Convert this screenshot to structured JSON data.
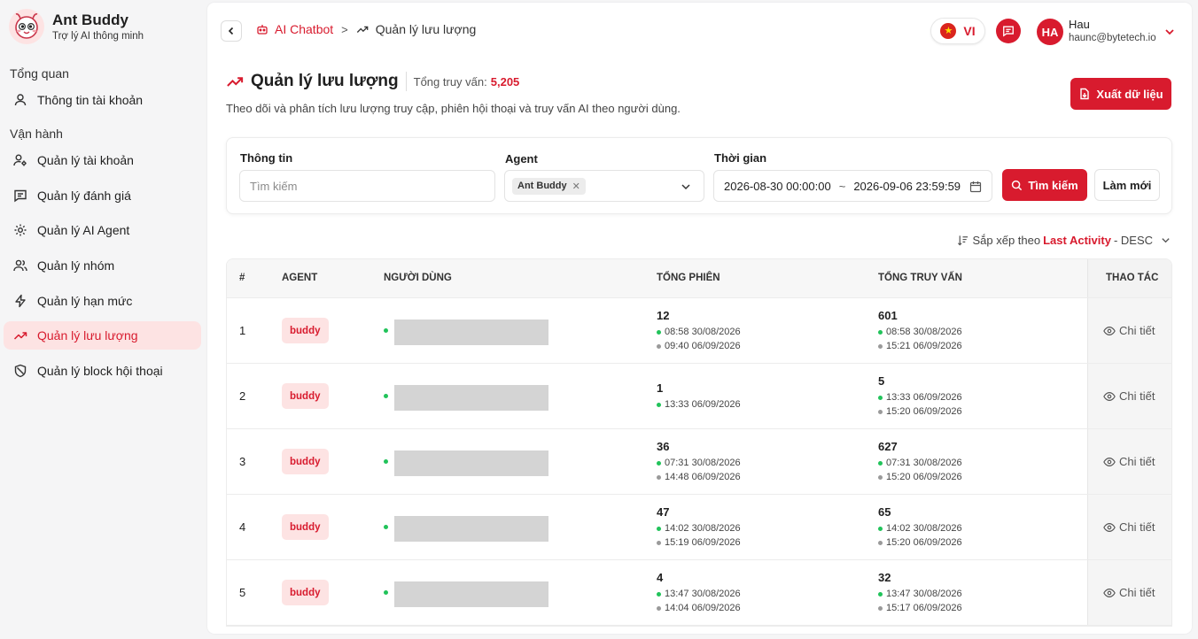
{
  "brand": {
    "name": "Ant Buddy",
    "subtitle": "Trợ lý AI thông minh"
  },
  "sidebar": {
    "section_overview": "Tổng quan",
    "section_ops": "Vận hành",
    "items": [
      {
        "label": "Thông tin tài khoản",
        "icon": "user-icon"
      },
      {
        "label": "Quản lý tài khoản",
        "icon": "user-settings-icon"
      },
      {
        "label": "Quản lý đánh giá",
        "icon": "message-square-icon"
      },
      {
        "label": "Quản lý AI Agent",
        "icon": "gear-icon"
      },
      {
        "label": "Quản lý nhóm",
        "icon": "users-icon"
      },
      {
        "label": "Quản lý hạn mức",
        "icon": "lightning-icon"
      },
      {
        "label": "Quản lý lưu lượng",
        "icon": "trending-up-icon",
        "active": true
      },
      {
        "label": "Quản lý block hội thoại",
        "icon": "shield-icon"
      }
    ]
  },
  "breadcrumb": {
    "parent": "AI Chatbot",
    "separator": ">",
    "current": "Quản lý lưu lượng"
  },
  "header": {
    "language": "VI",
    "user": {
      "initials": "HA",
      "name": "Hau",
      "email": "haunc@bytetech.io"
    }
  },
  "page": {
    "title": "Quản lý lưu lượng",
    "total_label": "Tổng truy vấn:",
    "total_value": "5,205",
    "description": "Theo dõi và phân tích lưu lượng truy cập, phiên hội thoại và truy vấn AI theo người dùng.",
    "export_label": "Xuất dữ liệu"
  },
  "filters": {
    "info_label": "Thông tin",
    "search_placeholder": "Tìm kiếm",
    "agent_label": "Agent",
    "agent_tag": "Ant Buddy",
    "time_label": "Thời gian",
    "time_start": "2026-08-30 00:00:00",
    "time_sep": "~",
    "time_end": "2026-09-06 23:59:59",
    "search_btn": "Tìm kiếm",
    "reset_btn": "Làm mới"
  },
  "sort": {
    "prefix": "Sắp xếp theo",
    "field": "Last Activity",
    "order": "- DESC"
  },
  "table": {
    "headers": {
      "idx": "#",
      "agent": "AGENT",
      "user": "NGƯỜI DÙNG",
      "sessions": "TỔNG PHIÊN",
      "queries": "TỔNG TRUY VẤN",
      "actions": "THAO TÁC"
    },
    "detail_label": "Chi tiết",
    "rows": [
      {
        "idx": "1",
        "agent": "buddy",
        "sessions": "12",
        "s_first": "08:58 30/08/2026",
        "s_last": "09:40 06/09/2026",
        "queries": "601",
        "q_first": "08:58 30/08/2026",
        "q_last": "15:21 06/09/2026"
      },
      {
        "idx": "2",
        "agent": "buddy",
        "sessions": "1",
        "s_first": "13:33 06/09/2026",
        "s_last": "",
        "queries": "5",
        "q_first": "13:33 06/09/2026",
        "q_last": "15:20 06/09/2026"
      },
      {
        "idx": "3",
        "agent": "buddy",
        "sessions": "36",
        "s_first": "07:31 30/08/2026",
        "s_last": "14:48 06/09/2026",
        "queries": "627",
        "q_first": "07:31 30/08/2026",
        "q_last": "15:20 06/09/2026"
      },
      {
        "idx": "4",
        "agent": "buddy",
        "sessions": "47",
        "s_first": "14:02 30/08/2026",
        "s_last": "15:19 06/09/2026",
        "queries": "65",
        "q_first": "14:02 30/08/2026",
        "q_last": "15:20 06/09/2026"
      },
      {
        "idx": "5",
        "agent": "buddy",
        "sessions": "4",
        "s_first": "13:47 30/08/2026",
        "s_last": "14:04 06/09/2026",
        "queries": "32",
        "q_first": "13:47 30/08/2026",
        "q_last": "15:17 06/09/2026"
      }
    ]
  },
  "colors": {
    "accent": "#d81b2e",
    "accent_soft": "#fde3e3",
    "online": "#21c35a"
  }
}
